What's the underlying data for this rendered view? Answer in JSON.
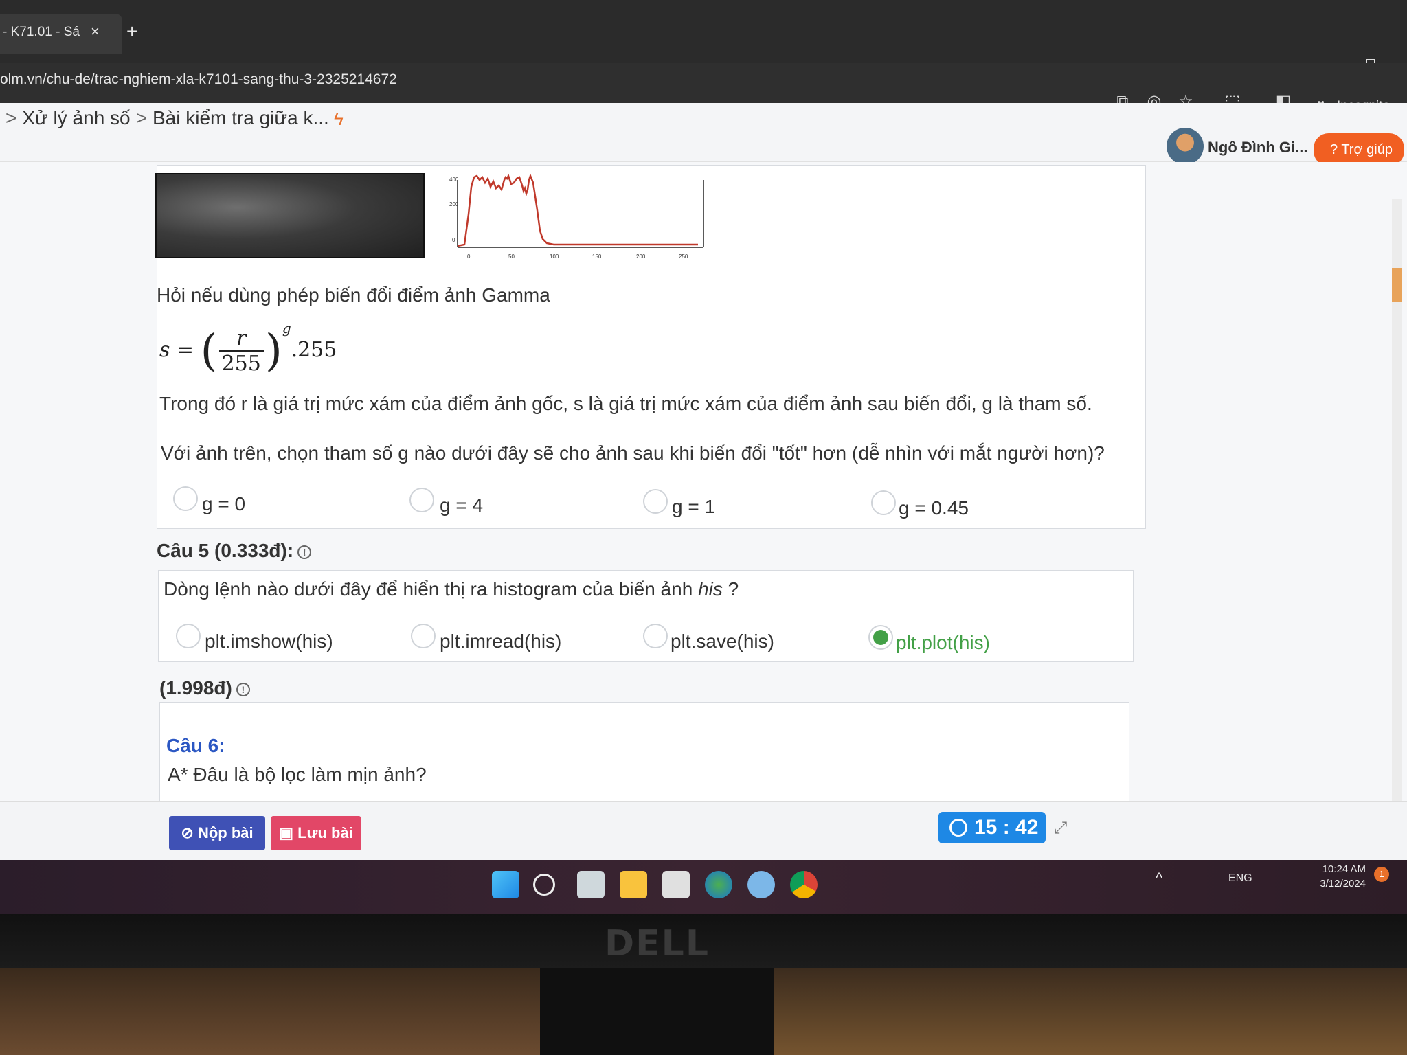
{
  "browser": {
    "tab_title": "- K71.01 - Sá",
    "tab_close": "×",
    "new_tab": "+",
    "url": "olm.vn/chu-de/trac-nghiem-xla-k7101-sang-thu-3-2325214672",
    "incognito_label": "Incognito",
    "minimize": "–"
  },
  "header": {
    "breadcrumb": [
      ">",
      "Xử lý ảnh số",
      ">",
      "Bài kiểm tra giữa k..."
    ],
    "user_name": "Ngô Đình Gi...",
    "help_button": "Trợ giúp"
  },
  "question4": {
    "histogram_ticks_x": [
      "0",
      "50",
      "100",
      "150",
      "200",
      "250"
    ],
    "histogram_ticks_y": [
      "400",
      "200",
      "0"
    ],
    "prompt": "Hỏi nếu dùng phép biến đổi điểm ảnh Gamma",
    "formula": {
      "lhs": "s =",
      "num": "r",
      "den": "255",
      "exp": "g",
      "tail": ".255"
    },
    "explanation": "Trong đó r là giá trị mức xám của điểm ảnh gốc, s là giá trị mức xám của điểm ảnh sau biến đổi, g là tham số.",
    "question": "Với ảnh trên, chọn tham số g nào dưới đây sẽ cho ảnh sau khi biến đổi \"tốt\" hơn (dễ nhìn với mắt người hơn)?",
    "options": [
      "g = 0",
      "g = 4",
      "g = 1",
      "g = 0.45"
    ]
  },
  "question5": {
    "title": "Câu 5 (0.333đ):",
    "prompt_a": "Dòng lệnh nào dưới đây để hiển thị ra histogram của biến ảnh ",
    "prompt_var": "his",
    "prompt_b": " ?",
    "options": [
      "plt.imshow(his)",
      "plt.imread(his)",
      "plt.save(his)",
      "plt.plot(his)"
    ],
    "selected_index": 3
  },
  "question6": {
    "points": "(1.998đ)",
    "title": "Câu 6:",
    "text": "A* Đâu là bộ lọc làm mịn ảnh?"
  },
  "actions": {
    "submit": "Nộp bài",
    "save": "Lưu bài",
    "timer": "15 : 42"
  },
  "taskbar": {
    "lang": "ENG",
    "time": "10:24 AM",
    "date": "3/12/2024",
    "notifications": "1"
  },
  "monitor_brand": "DELL",
  "colors": {
    "primary": "#3f51b5",
    "danger": "#e24767",
    "timer": "#1e88e5",
    "help": "#f15f22",
    "selected": "#43a047",
    "histogram_line": "#c0392b"
  }
}
